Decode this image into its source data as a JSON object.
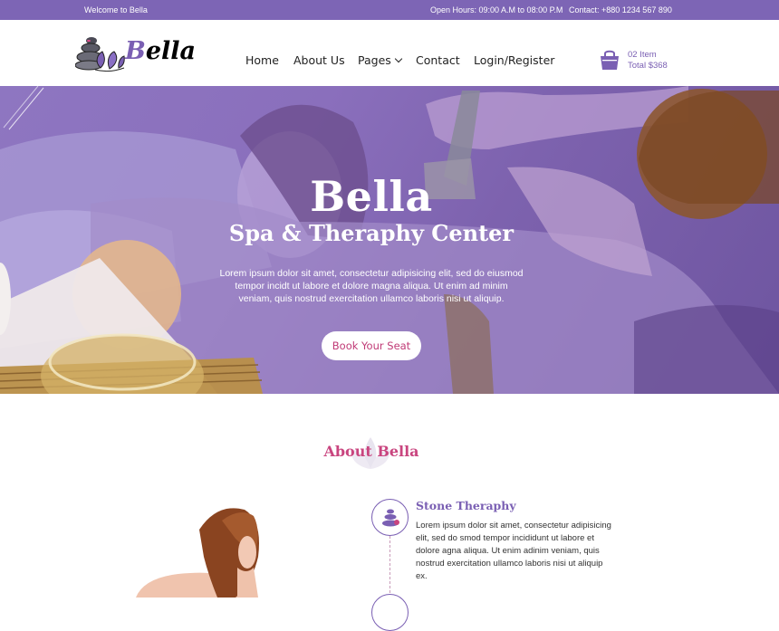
{
  "topbar": {
    "welcome": "Welcome to Bella",
    "hours": "Open Hours: 09:00 A.M to 08:00 P.M",
    "contact": "Contact: +880 1234 567 890"
  },
  "header": {
    "logo_text": "Bella",
    "nav": {
      "home": "Home",
      "about": "About Us",
      "pages": "Pages",
      "contact": "Contact",
      "login": "Login/Register"
    },
    "cart": {
      "items": "02 Item",
      "total": "Total $368"
    }
  },
  "hero": {
    "title": "Bella",
    "subtitle": "Spa & Theraphy Center",
    "text": "Lorem ipsum dolor sit amet, consectetur adipisicing elit, sed do eiusmod tempor incidt ut labore et dolore magna aliqua. Ut enim ad minim veniam, quis nostrud exercitation ullamco laboris nisi ut aliquip.",
    "button": "Book Your Seat"
  },
  "about": {
    "title": "About Bella",
    "features": [
      {
        "title": "Stone Theraphy",
        "text": "Lorem ipsum dolor sit amet, consectetur adipisicing elit, sed do smod tempor incididunt ut labore et dolore agna aliqua. Ut enim adinim veniam, quis nostrud exercitation ullamco laboris nisi ut aliquip ex.",
        "icon": "stone-stack-icon"
      }
    ]
  },
  "colors": {
    "brand": "#7d65b5",
    "accent": "#c9457f"
  }
}
